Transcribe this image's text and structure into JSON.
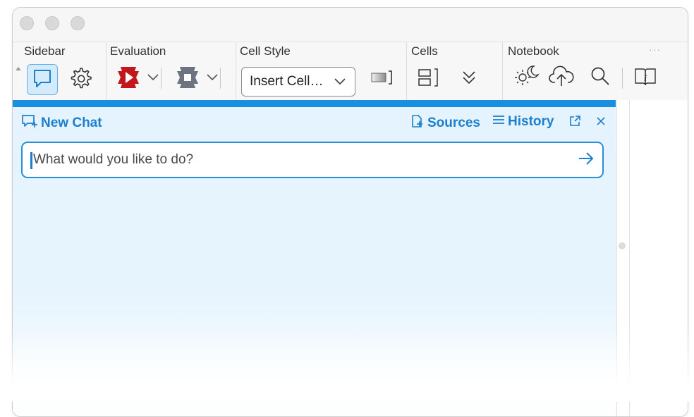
{
  "toolbar": {
    "sidebar": {
      "label": "Sidebar",
      "chat_icon": "chat-bubble-icon",
      "settings_icon": "gear-icon"
    },
    "evaluation": {
      "label": "Evaluation",
      "evaluate_icon": "evaluate-icon",
      "abort_icon": "abort-icon"
    },
    "cell_style": {
      "label": "Cell Style",
      "select_value": "Insert Cell…"
    },
    "cells": {
      "label": "Cells"
    },
    "notebook": {
      "label": "Notebook",
      "more_label": "···"
    }
  },
  "chat": {
    "new_chat_label": "New Chat",
    "sources_label": "Sources",
    "history_label": "History",
    "input_placeholder": "What would you like to do?"
  },
  "colors": {
    "accent": "#1a7fcf",
    "top_bar": "#1a8ee0",
    "panel_bg": "#e4f3fd",
    "evaluate_red": "#c2171d",
    "abort_gray": "#6d7380"
  }
}
